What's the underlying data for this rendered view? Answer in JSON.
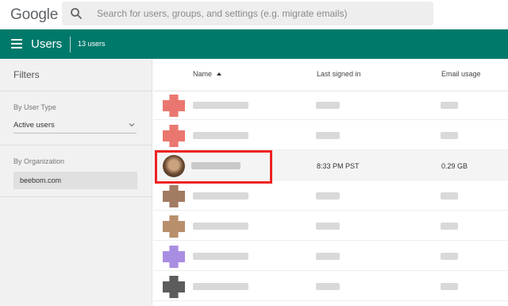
{
  "app": {
    "logo": "Google",
    "search_placeholder": "Search for users, groups, and settings (e.g. migrate emails)"
  },
  "header": {
    "title": "Users",
    "count": "13 users",
    "brand_color": "#00796b"
  },
  "sidebar": {
    "title": "Filters",
    "user_type_label": "By User Type",
    "user_type_value": "Active users",
    "org_label": "By Organization",
    "org_value": "beebom.com"
  },
  "table": {
    "columns": [
      "Name",
      "Last signed in",
      "Email usage"
    ],
    "sort_icon": "sort-ascending-icon",
    "rows": [
      {
        "avatar_color": "#e5554b",
        "last_signed_in": "",
        "email_usage": ""
      },
      {
        "avatar_color": "#e5554b",
        "last_signed_in": "",
        "email_usage": ""
      },
      {
        "avatar_color": "#6b4a30",
        "last_signed_in": "8:33 PM PST",
        "email_usage": "0.29 GB",
        "highlighted": true
      },
      {
        "avatar_color": "#8b5a3c",
        "last_signed_in": "",
        "email_usage": ""
      },
      {
        "avatar_color": "#a57346",
        "last_signed_in": "",
        "email_usage": ""
      },
      {
        "avatar_color": "#9370db",
        "last_signed_in": "",
        "email_usage": ""
      },
      {
        "avatar_color": "#333333",
        "last_signed_in": "",
        "email_usage": ""
      }
    ]
  },
  "highlight_color": "#ee2222"
}
